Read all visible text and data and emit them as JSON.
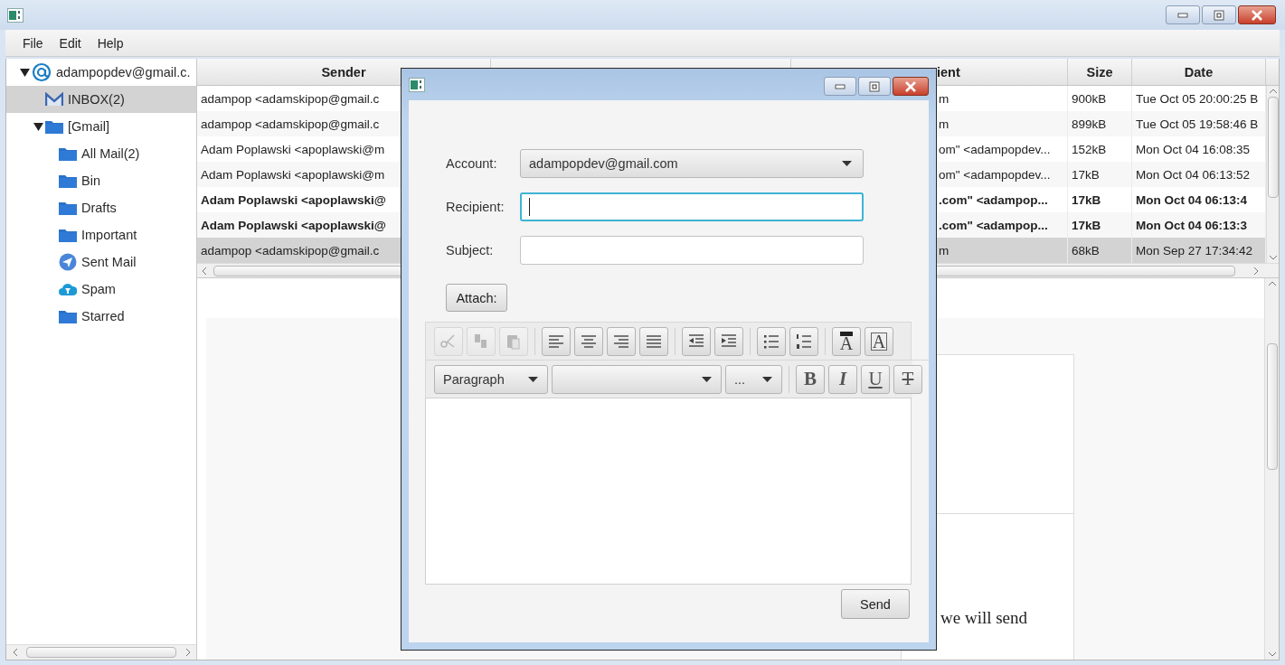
{
  "menu": [
    "File",
    "Edit",
    "Help"
  ],
  "folder_tree": {
    "items": [
      {
        "label": "adampopdev@gmail.c.",
        "kind": "account",
        "expanded": true,
        "selected": false,
        "children": [
          {
            "label": "INBOX(2)",
            "kind": "inbox",
            "selected": true
          },
          {
            "label": "[Gmail]",
            "kind": "folder",
            "expanded": true,
            "selected": false,
            "children": [
              {
                "label": "All Mail(2)",
                "kind": "folder",
                "selected": false
              },
              {
                "label": "Bin",
                "kind": "folder",
                "selected": false
              },
              {
                "label": "Drafts",
                "kind": "folder",
                "selected": false
              },
              {
                "label": "Important",
                "kind": "folder",
                "selected": false
              },
              {
                "label": "Sent Mail",
                "kind": "sent",
                "selected": false
              },
              {
                "label": "Spam",
                "kind": "spam",
                "selected": false
              },
              {
                "label": "Starred",
                "kind": "folder",
                "selected": false
              }
            ]
          }
        ]
      }
    ]
  },
  "message_table": {
    "columns": {
      "sender": "Sender",
      "recipient": "ient",
      "size": "Size",
      "date": "Date"
    },
    "rows": [
      {
        "sender": "adampop <adamskipop@gmail.c",
        "recipient": "m",
        "size": "900kB",
        "date": "Tue Oct 05 20:00:25 B",
        "unread": false,
        "selected": false
      },
      {
        "sender": "adampop <adamskipop@gmail.c",
        "recipient": "m",
        "size": "899kB",
        "date": "Tue Oct 05 19:58:46 B",
        "unread": false,
        "selected": false
      },
      {
        "sender": "Adam Poplawski <apoplawski@m",
        "recipient": "om\" <adampopdev...",
        "size": "152kB",
        "date": "Mon Oct 04 16:08:35",
        "unread": false,
        "selected": false
      },
      {
        "sender": "Adam Poplawski <apoplawski@m",
        "recipient": "om\" <adampopdev...",
        "size": "17kB",
        "date": "Mon Oct 04 06:13:52",
        "unread": false,
        "selected": false
      },
      {
        "sender": "Adam Poplawski <apoplawski@",
        "recipient": ".com\" <adampop...",
        "size": "17kB",
        "date": "Mon Oct 04 06:13:4",
        "unread": true,
        "selected": false
      },
      {
        "sender": "Adam Poplawski <apoplawski@",
        "recipient": ".com\" <adampop...",
        "size": "17kB",
        "date": "Mon Oct 04 06:13:3",
        "unread": true,
        "selected": false
      },
      {
        "sender": "adampop <adamskipop@gmail.c",
        "recipient": "m",
        "size": "68kB",
        "date": "Mon Sep 27 17:34:42",
        "unread": false,
        "selected": true
      }
    ]
  },
  "preview": {
    "text": "we will send"
  },
  "compose_dialog": {
    "account_label": "Account:",
    "account": "adampopdev@gmail.com",
    "recipient_label": "Recipient:",
    "recipient_focused": true,
    "subject_label": "Subject:",
    "attach_button": "Attach:",
    "toolbar_groups": [
      [
        {
          "kind": "cut",
          "disabled": true
        },
        {
          "kind": "copy",
          "disabled": true
        },
        {
          "kind": "paste",
          "disabled": true
        }
      ],
      [
        {
          "kind": "align-left",
          "disabled": false
        },
        {
          "kind": "align-center",
          "disabled": false
        },
        {
          "kind": "align-right",
          "disabled": false
        },
        {
          "kind": "justify",
          "disabled": false
        }
      ],
      [
        {
          "kind": "outdent",
          "disabled": false
        },
        {
          "kind": "indent",
          "disabled": false
        }
      ],
      [
        {
          "kind": "bullets",
          "disabled": false
        },
        {
          "kind": "numbers",
          "disabled": false
        }
      ],
      [
        {
          "kind": "text-color",
          "label": "A",
          "disabled": false
        },
        {
          "kind": "highlight",
          "label": "A",
          "disabled": false
        }
      ]
    ],
    "format": "Paragraph",
    "font_size": "...",
    "style_tools": [
      {
        "kind": "bold",
        "label": "B"
      },
      {
        "kind": "italic",
        "label": "I"
      },
      {
        "kind": "underline",
        "label": "U"
      },
      {
        "kind": "strike",
        "label": "T"
      }
    ],
    "send_button": "Send"
  }
}
